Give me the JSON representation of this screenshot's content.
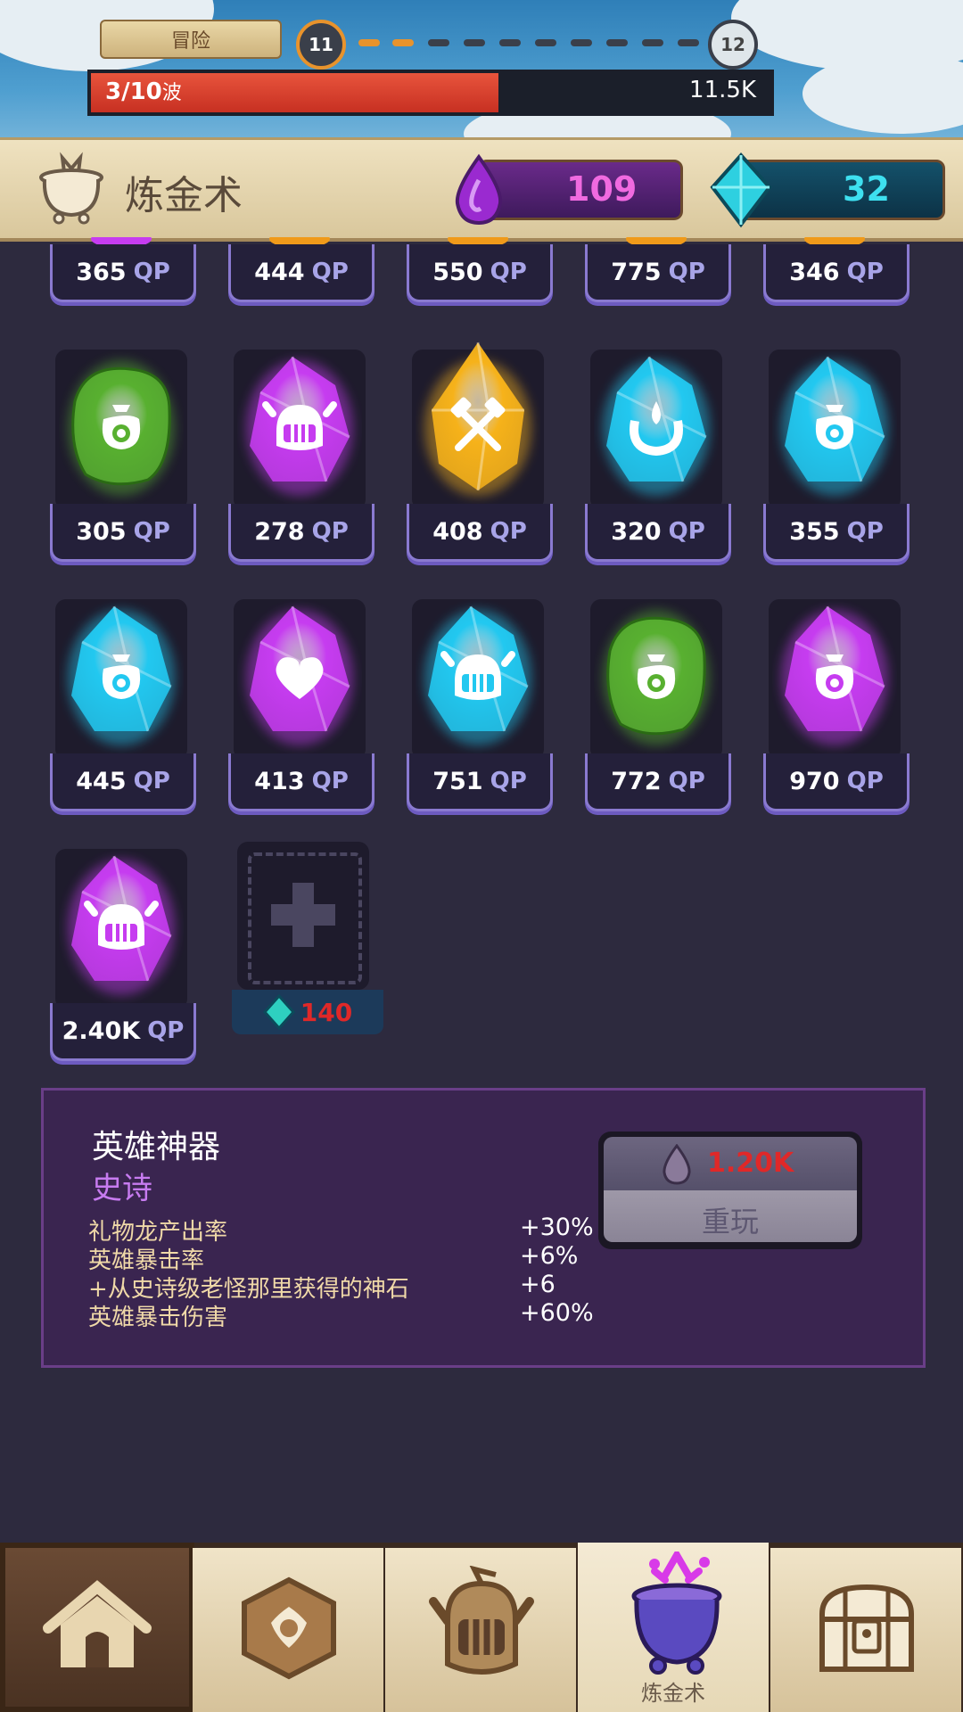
{
  "top": {
    "adventure_label": "冒险",
    "current_level": "11",
    "next_level": "12",
    "wave_text": "3/10",
    "wave_suffix": "波",
    "wave_progress": 0.6,
    "damage": "11.5K"
  },
  "header": {
    "title": "炼金术",
    "purple_currency": "109",
    "gem_currency": "32"
  },
  "artifacts": {
    "unit": "QP",
    "rows": [
      [
        {
          "value": "365",
          "color": "purple",
          "icon": "partial-gem"
        },
        {
          "value": "444",
          "color": "orange",
          "icon": "partial-gem"
        },
        {
          "value": "550",
          "color": "orange",
          "icon": "partial-gem"
        },
        {
          "value": "775",
          "color": "orange",
          "icon": "partial-gem"
        },
        {
          "value": "346",
          "color": "orange",
          "icon": "partial-gem"
        }
      ],
      [
        {
          "value": "305",
          "color": "green",
          "icon": "money-bag-icon"
        },
        {
          "value": "278",
          "color": "purple",
          "icon": "helmet-icon"
        },
        {
          "value": "408",
          "color": "gold",
          "icon": "crossed-tools-icon"
        },
        {
          "value": "320",
          "color": "cyan",
          "icon": "drop-ring-icon"
        },
        {
          "value": "355",
          "color": "cyan",
          "icon": "money-bag-icon"
        }
      ],
      [
        {
          "value": "445",
          "color": "cyan",
          "icon": "money-bag-icon"
        },
        {
          "value": "413",
          "color": "purple",
          "icon": "heart-icon"
        },
        {
          "value": "751",
          "color": "cyan",
          "icon": "helmet-icon"
        },
        {
          "value": "772",
          "color": "green",
          "icon": "money-bag-icon"
        },
        {
          "value": "970",
          "color": "purple",
          "icon": "money-bag-icon"
        }
      ],
      [
        {
          "value": "2.40K",
          "color": "purple",
          "icon": "helmet-icon"
        }
      ]
    ],
    "add_slot_cost": "140"
  },
  "detail": {
    "title": "英雄神器",
    "rarity": "史诗",
    "stats": [
      {
        "name": "礼物龙产出率",
        "value": "+30%"
      },
      {
        "name": "英雄暴击率",
        "value": "+6%"
      },
      {
        "name": "+从史诗级老怪那里获得的神石",
        "value": "+6"
      },
      {
        "name": "英雄暴击伤害",
        "value": "+60%"
      }
    ],
    "reroll_cost": "1.20K",
    "reroll_label": "重玩"
  },
  "nav": {
    "tabs": [
      {
        "id": "home",
        "icon": "house-icon"
      },
      {
        "id": "hex",
        "icon": "hexagon-badge-icon"
      },
      {
        "id": "hero",
        "icon": "knight-helmet-icon"
      },
      {
        "id": "alchemy",
        "icon": "cauldron-icon",
        "label": "炼金术"
      },
      {
        "id": "chest",
        "icon": "treasure-chest-icon"
      }
    ]
  },
  "colors": {
    "purple": "#c63cf0",
    "cyan": "#22c8f0",
    "green": "#58b030",
    "gold": "#f6b21a",
    "orange": "#f09a1a"
  }
}
